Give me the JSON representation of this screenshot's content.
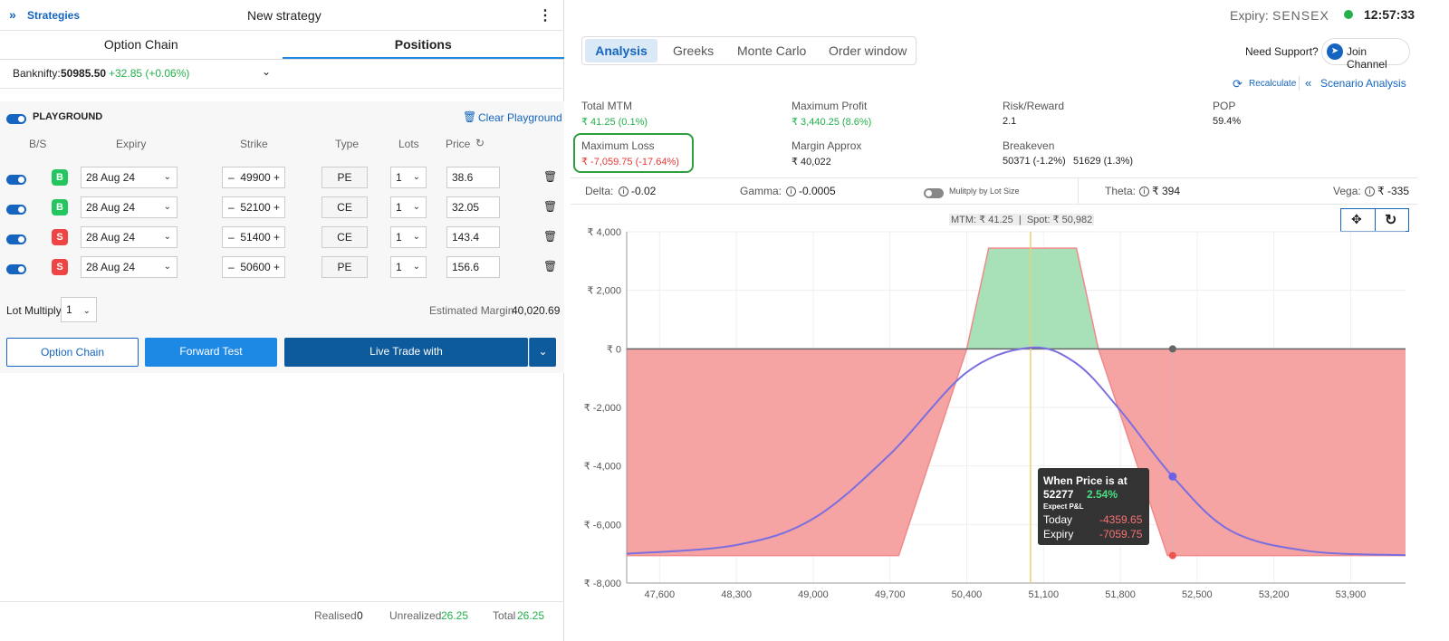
{
  "header": {
    "strategies_label": "Strategies",
    "strategy_name": "New strategy"
  },
  "left_tabs": [
    "Option Chain",
    "Positions"
  ],
  "underlying": {
    "label": "Banknifty:",
    "price": "50985.50",
    "change": "+32.85 (+0.06%)"
  },
  "playground": {
    "title": "PLAYGROUND",
    "clear_label": "Clear Playground",
    "columns": {
      "bs": "B/S",
      "expiry": "Expiry",
      "strike": "Strike",
      "type": "Type",
      "lots": "Lots",
      "price": "Price"
    },
    "legs": [
      {
        "side": "B",
        "expiry": "28 Aug 24",
        "strike": "49900",
        "type": "PE",
        "lots": "1",
        "price": "38.6"
      },
      {
        "side": "B",
        "expiry": "28 Aug 24",
        "strike": "52100",
        "type": "CE",
        "lots": "1",
        "price": "32.05"
      },
      {
        "side": "S",
        "expiry": "28 Aug 24",
        "strike": "51400",
        "type": "CE",
        "lots": "1",
        "price": "143.4"
      },
      {
        "side": "S",
        "expiry": "28 Aug 24",
        "strike": "50600",
        "type": "PE",
        "lots": "1",
        "price": "156.6"
      }
    ],
    "lot_multiply_label": "Lot Multiply",
    "lot_multiply_value": "1",
    "est_margin_label": "Estimated Margin",
    "est_margin_value": "40,020.69"
  },
  "buttons": {
    "option_chain": "Option Chain",
    "forward_test": "Forward Test",
    "live_trade": "Live Trade with"
  },
  "footer": {
    "realised_label": "Realised",
    "realised_value": "0",
    "unrealized_label": "Unrealized",
    "unrealized_value": "26.25",
    "total_label": "Total",
    "total_value": "26.25"
  },
  "right_header": {
    "expiry_label": "Expiry:",
    "expiry_value": "SENSEX",
    "time": "12:57:33"
  },
  "analysis_tabs": [
    "Analysis",
    "Greeks",
    "Monte Carlo",
    "Order window"
  ],
  "support": {
    "need_support": "Need Support?",
    "join_channel": "Join Channel"
  },
  "actions": {
    "recalculate": "Recalculate",
    "scenario": "Scenario Analysis"
  },
  "stats": {
    "total_mtm": {
      "label": "Total MTM",
      "value": "₹ 41.25 (0.1%)"
    },
    "max_profit": {
      "label": "Maximum Profit",
      "value": "₹ 3,440.25 (8.6%)"
    },
    "risk_reward": {
      "label": "Risk/Reward",
      "value": "2.1"
    },
    "pop": {
      "label": "POP",
      "value": "59.4%"
    },
    "max_loss": {
      "label": "Maximum Loss",
      "value": "₹ -7,059.75 (-17.64%)"
    },
    "margin": {
      "label": "Margin Approx",
      "value": "₹ 40,022"
    },
    "breakeven": {
      "label": "Breakeven",
      "value1": "50371 (-1.2%)",
      "value2": "51629 (1.3%)"
    }
  },
  "greeks": {
    "delta_label": "Delta:",
    "delta": "-0.02",
    "gamma_label": "Gamma:",
    "gamma": "-0.0005",
    "multiply_label": "Mulitply by Lot Size",
    "theta_label": "Theta:",
    "theta": "₹ 394",
    "vega_label": "Vega:",
    "vega": "₹ -335"
  },
  "chart_info": "MTM: ₹ 41.25  |  Spot: ₹ 50,982",
  "tooltip": {
    "title": "When Price is at",
    "price": "52277",
    "pct": "2.54%",
    "sub": "Expect P&L",
    "today_label": "Today",
    "today_value": "-4359.65",
    "expiry_label": "Expiry",
    "expiry_value": "-7059.75"
  },
  "colors": {
    "profit_fill": "#a8e0b8",
    "loss_fill": "#f5a3a3",
    "today_line": "#7b6fe0",
    "spot_line": "#e6d27a",
    "accent": "#1565c0"
  },
  "chart_data": {
    "type": "area",
    "x_ticks": [
      "47,600",
      "48,300",
      "49,000",
      "49,700",
      "50,400",
      "51,100",
      "51,800",
      "52,500",
      "53,200",
      "53,900"
    ],
    "y_ticks": [
      "₹ 4,000",
      "₹ 2,000",
      "₹ 0",
      "₹ -2,000",
      "₹ -4,000",
      "₹ -6,000",
      "₹ -8,000"
    ],
    "xlim": [
      47300,
      54400
    ],
    "ylim": [
      -8000,
      4000
    ],
    "spot": 50982,
    "series": [
      {
        "name": "Expiry",
        "x": [
          47300,
          49780,
          50400,
          50600,
          51400,
          51600,
          52230,
          54400
        ],
        "y": [
          -7059.75,
          -7059.75,
          0,
          3440.25,
          3440.25,
          0,
          -7059.75,
          -7059.75
        ]
      },
      {
        "name": "Today",
        "x": [
          47300,
          48300,
          49000,
          49700,
          50400,
          50982,
          51400,
          51800,
          52277,
          52800,
          53500,
          54400
        ],
        "y": [
          -7000,
          -6700,
          -5800,
          -3600,
          -800,
          41.25,
          -500,
          -2100,
          -4359.65,
          -6200,
          -6900,
          -7050
        ]
      }
    ]
  }
}
